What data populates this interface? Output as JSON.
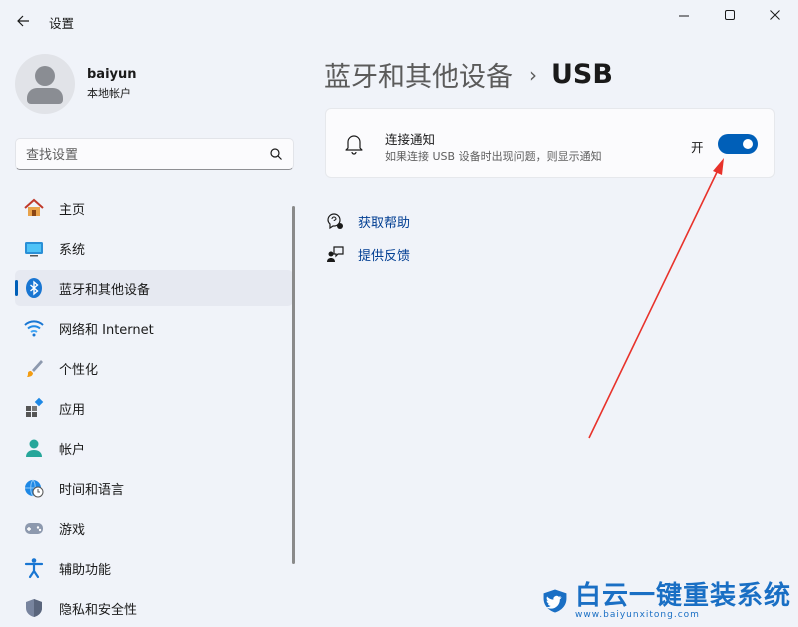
{
  "window": {
    "title": "设置"
  },
  "profile": {
    "name": "baiyun",
    "account_type": "本地帐户"
  },
  "search": {
    "placeholder": "查找设置"
  },
  "nav": {
    "items": [
      {
        "label": "主页",
        "icon": "home-icon"
      },
      {
        "label": "系统",
        "icon": "system-icon"
      },
      {
        "label": "蓝牙和其他设备",
        "icon": "bluetooth-icon",
        "active": true
      },
      {
        "label": "网络和 Internet",
        "icon": "wifi-icon"
      },
      {
        "label": "个性化",
        "icon": "brush-icon"
      },
      {
        "label": "应用",
        "icon": "apps-icon"
      },
      {
        "label": "帐户",
        "icon": "account-icon"
      },
      {
        "label": "时间和语言",
        "icon": "clock-globe-icon"
      },
      {
        "label": "游戏",
        "icon": "gamepad-icon"
      },
      {
        "label": "辅助功能",
        "icon": "accessibility-icon"
      },
      {
        "label": "隐私和安全性",
        "icon": "shield-icon"
      }
    ]
  },
  "breadcrumb": {
    "parent": "蓝牙和其他设备",
    "separator": "›",
    "current": "USB"
  },
  "usb_notification": {
    "title": "连接通知",
    "description": "如果连接 USB 设备时出现问题，则显示通知",
    "state_label": "开",
    "enabled": true
  },
  "links": {
    "help": "获取帮助",
    "feedback": "提供反馈"
  },
  "watermark": {
    "brand": "白云一键重装系统",
    "url": "www.baiyunxitong.com"
  },
  "colors": {
    "accent": "#005fb8",
    "annotation_arrow": "#e8322b",
    "watermark": "#1a6fc4"
  }
}
